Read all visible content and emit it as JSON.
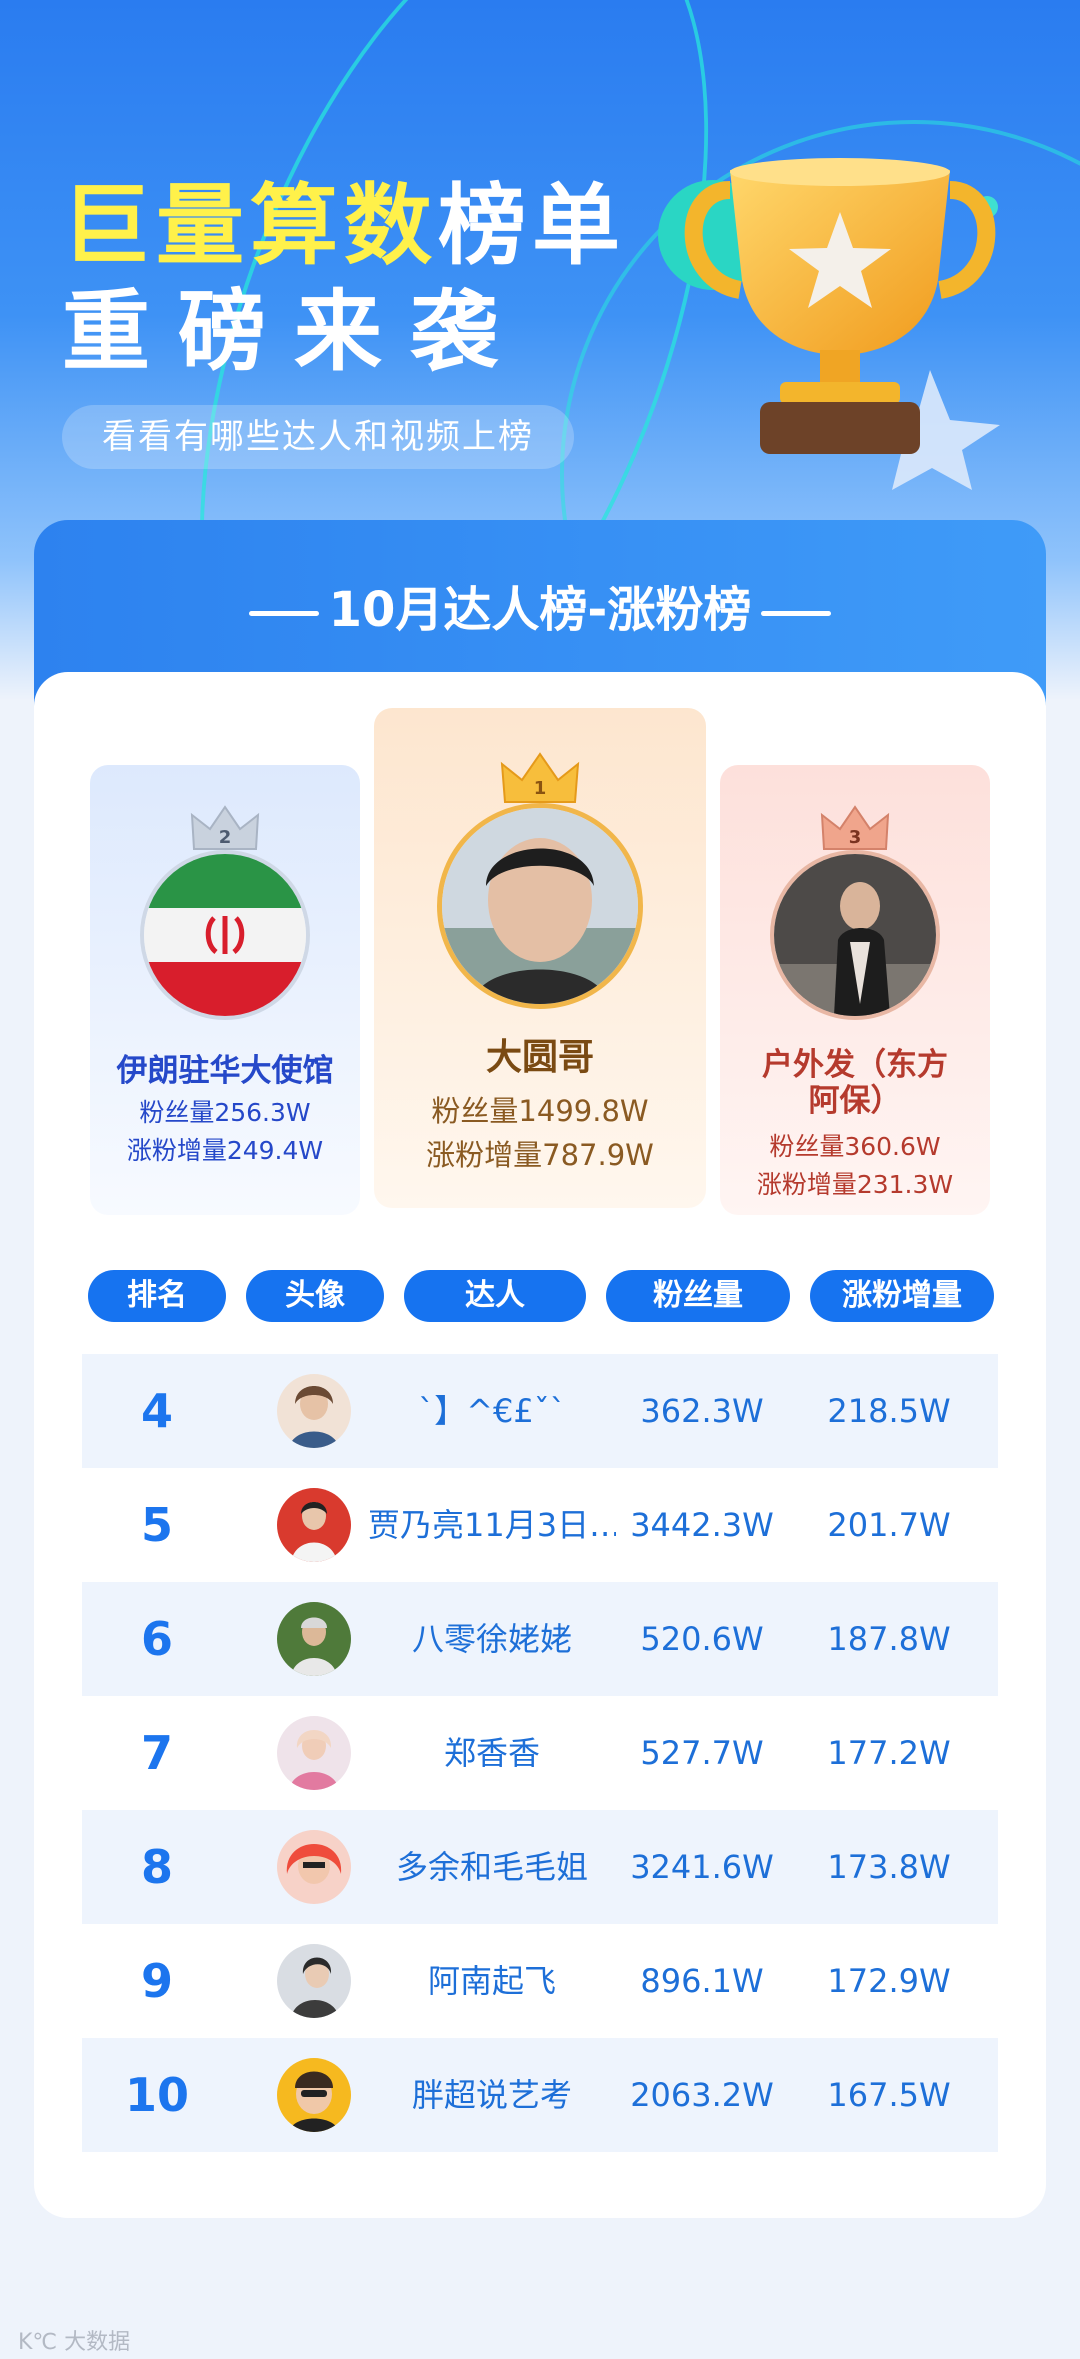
{
  "hero": {
    "title_highlight": "巨量算数",
    "title_rest": "榜单",
    "title_line2": "重磅来袭",
    "subtitle": "看看有哪些达人和视频上榜"
  },
  "list": {
    "title": "10月达人榜-涨粉榜"
  },
  "podium": [
    {
      "rank": "1",
      "name": "大圆哥",
      "fans": "粉丝量1499.8W",
      "growth": "涨粉增量787.9W"
    },
    {
      "rank": "2",
      "name": "伊朗驻华大使馆",
      "fans": "粉丝量256.3W",
      "growth": "涨粉增量249.4W"
    },
    {
      "rank": "3",
      "name_line1": "户外发（东方",
      "name_line2": "阿保）",
      "fans": "粉丝量360.6W",
      "growth": "涨粉增量231.3W"
    }
  ],
  "table": {
    "headers": [
      "排名",
      "头像",
      "达人",
      "粉丝量",
      "涨粉增量"
    ],
    "rows": [
      {
        "rank": "4",
        "name": "ˋ】^€£ˇˋ",
        "fans": "362.3W",
        "growth": "218.5W"
      },
      {
        "rank": "5",
        "name": "贾乃亮11月3日…",
        "fans": "3442.3W",
        "growth": "201.7W"
      },
      {
        "rank": "6",
        "name": "八零徐姥姥",
        "fans": "520.6W",
        "growth": "187.8W"
      },
      {
        "rank": "7",
        "name": "郑香香",
        "fans": "527.7W",
        "growth": "177.2W"
      },
      {
        "rank": "8",
        "name": "多余和毛毛姐",
        "fans": "3241.6W",
        "growth": "173.8W"
      },
      {
        "rank": "9",
        "name": "阿南起飞",
        "fans": "896.1W",
        "growth": "172.9W"
      },
      {
        "rank": "10",
        "name": "胖超说艺考",
        "fans": "2063.2W",
        "growth": "167.5W"
      }
    ]
  },
  "watermark": "K℃ 大数据"
}
